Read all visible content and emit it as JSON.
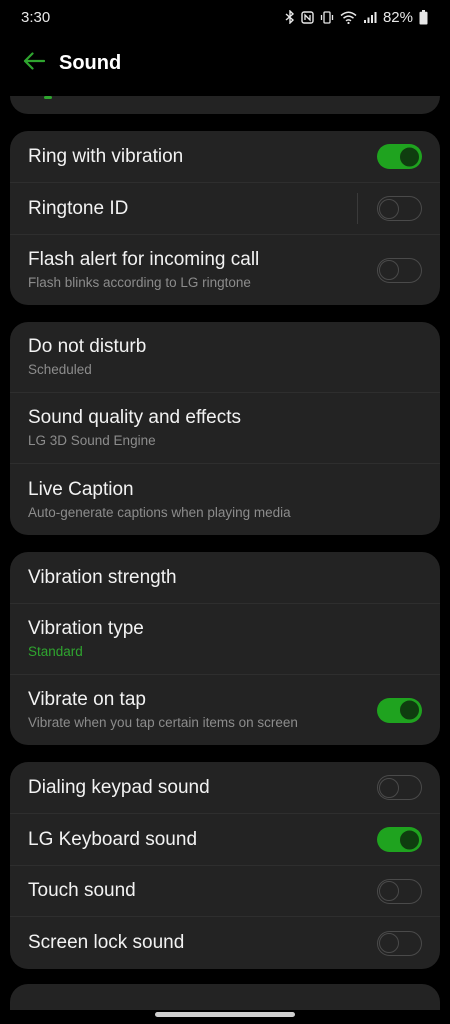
{
  "status_bar": {
    "time": "3:30",
    "battery": "82%",
    "icons": [
      "bluetooth-icon",
      "nfc-icon",
      "vibrate-icon",
      "wifi-icon",
      "signal-icon",
      "battery-icon"
    ]
  },
  "header": {
    "title": "Sound",
    "back_icon": "back-arrow-icon"
  },
  "colors": {
    "accent": "#1fa31f",
    "background": "#000000",
    "card": "#232323"
  },
  "cards": [
    {
      "items": [
        {
          "title": "Ring with vibration",
          "toggle": "on"
        },
        {
          "title": "Ringtone ID",
          "toggle": "off"
        },
        {
          "title": "Flash alert for incoming call",
          "subtitle": "Flash blinks according to LG ringtone",
          "toggle": "off"
        }
      ]
    },
    {
      "items": [
        {
          "title": "Do not disturb",
          "subtitle": "Scheduled"
        },
        {
          "title": "Sound quality and effects",
          "subtitle": "LG 3D Sound Engine"
        },
        {
          "title": "Live Caption",
          "subtitle": "Auto-generate captions when playing media"
        }
      ]
    },
    {
      "items": [
        {
          "title": "Vibration strength"
        },
        {
          "title": "Vibration type",
          "subtitle": "Standard"
        },
        {
          "title": "Vibrate on tap",
          "subtitle": "Vibrate when you tap certain items on screen",
          "toggle": "on"
        }
      ]
    },
    {
      "items": [
        {
          "title": "Dialing keypad sound",
          "toggle": "off"
        },
        {
          "title": "LG Keyboard sound",
          "toggle": "on"
        },
        {
          "title": "Touch sound",
          "toggle": "off"
        },
        {
          "title": "Screen lock sound",
          "toggle": "off"
        }
      ]
    }
  ]
}
